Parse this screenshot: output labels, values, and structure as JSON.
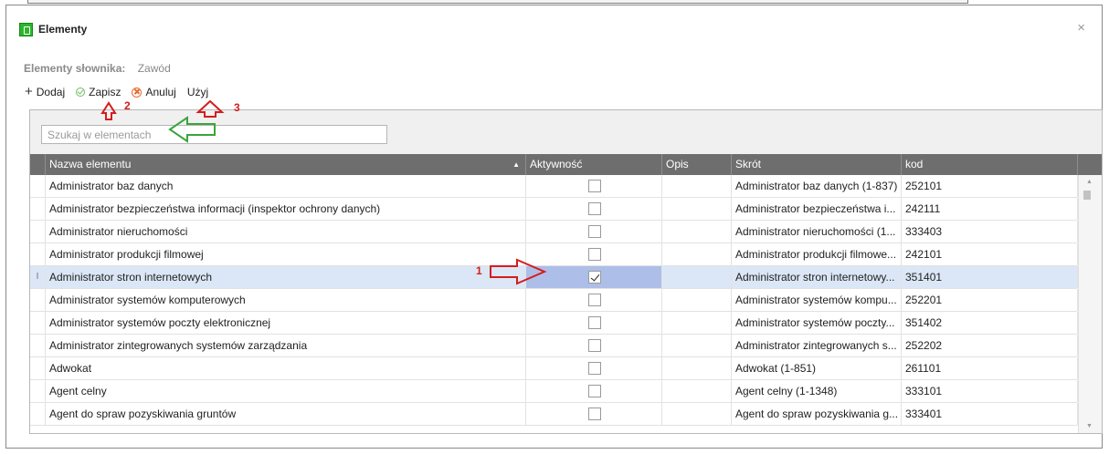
{
  "window": {
    "title": "Elementy",
    "close_glyph": "×"
  },
  "dictionary": {
    "label": "Elementy słownika:",
    "value": "Zawód"
  },
  "toolbar": {
    "add_label": "Dodaj",
    "save_label": "Zapisz",
    "cancel_label": "Anuluj",
    "use_label": "Użyj"
  },
  "search": {
    "placeholder": "Szukaj w elementach",
    "value": ""
  },
  "grid": {
    "columns": [
      "Nazwa elementu",
      "Aktywność",
      "Opis",
      "Skrót",
      "kod"
    ],
    "sorted_column": "Nazwa elementu",
    "sort_direction": "ascending",
    "current_row_marker": "I",
    "rows": [
      {
        "name": "Administrator baz danych",
        "active": false,
        "desc": "",
        "short": "Administrator baz danych (1-837)",
        "code": "252101"
      },
      {
        "name": "Administrator bezpieczeństwa informacji (inspektor ochrony danych)",
        "active": false,
        "desc": "",
        "short": "Administrator bezpieczeństwa i...",
        "code": "242111"
      },
      {
        "name": "Administrator nieruchomości",
        "active": false,
        "desc": "",
        "short": "Administrator nieruchomości (1...",
        "code": "333403"
      },
      {
        "name": "Administrator produkcji filmowej",
        "active": false,
        "desc": "",
        "short": "Administrator produkcji filmowe...",
        "code": "242101"
      },
      {
        "name": "Administrator stron internetowych",
        "active": true,
        "desc": "",
        "short": "Administrator stron internetowy...",
        "code": "351401",
        "selected": true
      },
      {
        "name": "Administrator systemów komputerowych",
        "active": false,
        "desc": "",
        "short": "Administrator systemów kompu...",
        "code": "252201"
      },
      {
        "name": "Administrator systemów poczty elektronicznej",
        "active": false,
        "desc": "",
        "short": "Administrator systemów poczty...",
        "code": "351402"
      },
      {
        "name": "Administrator zintegrowanych systemów zarządzania",
        "active": false,
        "desc": "",
        "short": "Administrator zintegrowanych s...",
        "code": "252202"
      },
      {
        "name": "Adwokat",
        "active": false,
        "desc": "",
        "short": "Adwokat (1-851)",
        "code": "261101"
      },
      {
        "name": "Agent celny",
        "active": false,
        "desc": "",
        "short": "Agent celny (1-1348)",
        "code": "333101"
      },
      {
        "name": "Agent do spraw pozyskiwania gruntów",
        "active": false,
        "desc": "",
        "short": "Agent do spraw pozyskiwania g...",
        "code": "333401"
      }
    ]
  },
  "annotations": {
    "active_checkbox_marker": "1",
    "save_marker": "2",
    "use_marker": "3",
    "colors": {
      "marker": "#d41d1d",
      "search_arrow": "#3aa53a"
    }
  },
  "colors": {
    "header_bg": "#6e6e6e",
    "selected_row": "#dbe7f6",
    "selected_cell": "#adbfe8",
    "app_icon": "#2db52d"
  }
}
